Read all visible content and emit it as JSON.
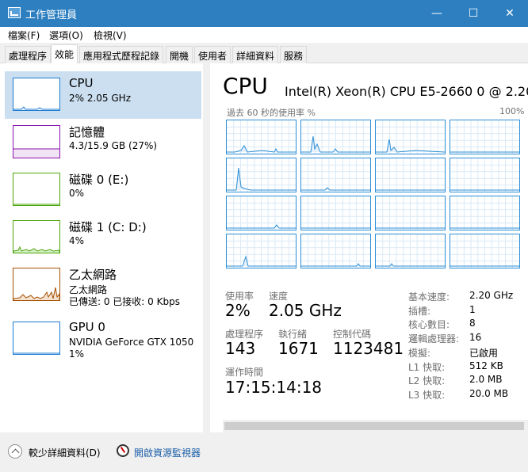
{
  "window": {
    "title": "工作管理員",
    "controls": {
      "minimize": "—",
      "maximize": "☐",
      "close": "✕"
    }
  },
  "menu": [
    "檔案(F)",
    "選項(O)",
    "檢視(V)"
  ],
  "tabs": [
    "處理程序",
    "效能",
    "應用程式歷程記錄",
    "開機",
    "使用者",
    "詳細資料",
    "服務"
  ],
  "active_tab": "效能",
  "sidebar": {
    "items": [
      {
        "name": "CPU",
        "line2": "2% 2.05 GHz",
        "line3": "",
        "color": "#1c7bd1",
        "active": true
      },
      {
        "name": "記憶體",
        "line2": "4.3/15.9 GB (27%)",
        "line3": "",
        "color": "#8b12ae",
        "active": false
      },
      {
        "name": "磁碟 0 (E:)",
        "line2": "0%",
        "line3": "",
        "color": "#4da60c",
        "active": false
      },
      {
        "name": "磁碟 1 (C: D:)",
        "line2": "4%",
        "line3": "",
        "color": "#4da60c",
        "active": false
      },
      {
        "name": "乙太網路",
        "line2": "乙太網路",
        "line3": "已傳送: 0 已接收: 0 Kbps",
        "color": "#a74f01",
        "active": false
      },
      {
        "name": "GPU 0",
        "line2": "NVIDIA GeForce GTX 1050",
        "line3": "1%",
        "color": "#1c7bd1",
        "active": false
      }
    ]
  },
  "main": {
    "title": "CPU",
    "model": "Intel(R) Xeon(R) CPU E5-2660 0 @ 2.20",
    "graph_label_left": "過去 60 秒的使用率 %",
    "graph_label_right": "100%",
    "graph_color": "#2c8ed6",
    "stats": {
      "utilization_label": "使用率",
      "utilization_value": "2%",
      "speed_label": "速度",
      "speed_value": "2.05 GHz",
      "processes_label": "處理程序",
      "processes_value": "143",
      "threads_label": "執行緒",
      "threads_value": "1671",
      "handles_label": "控制代碼",
      "handles_value": "1123481",
      "uptime_label": "運作時間",
      "uptime_value": "17:15:14:18"
    },
    "specs": [
      {
        "label": "基本速度:",
        "value": "2.20 GHz"
      },
      {
        "label": "插槽:",
        "value": "1"
      },
      {
        "label": "核心數目:",
        "value": "8"
      },
      {
        "label": "邏輯處理器:",
        "value": "16"
      },
      {
        "label": "模擬:",
        "value": "已啟用"
      },
      {
        "label": "L1 快取:",
        "value": "512 KB"
      },
      {
        "label": "L2 快取:",
        "value": "2.0 MB"
      },
      {
        "label": "L3 快取:",
        "value": "20.0 MB"
      }
    ]
  },
  "footer": {
    "fewer_details": "較少詳細資料(D)",
    "resource_monitor": "開啟資源監視器"
  }
}
